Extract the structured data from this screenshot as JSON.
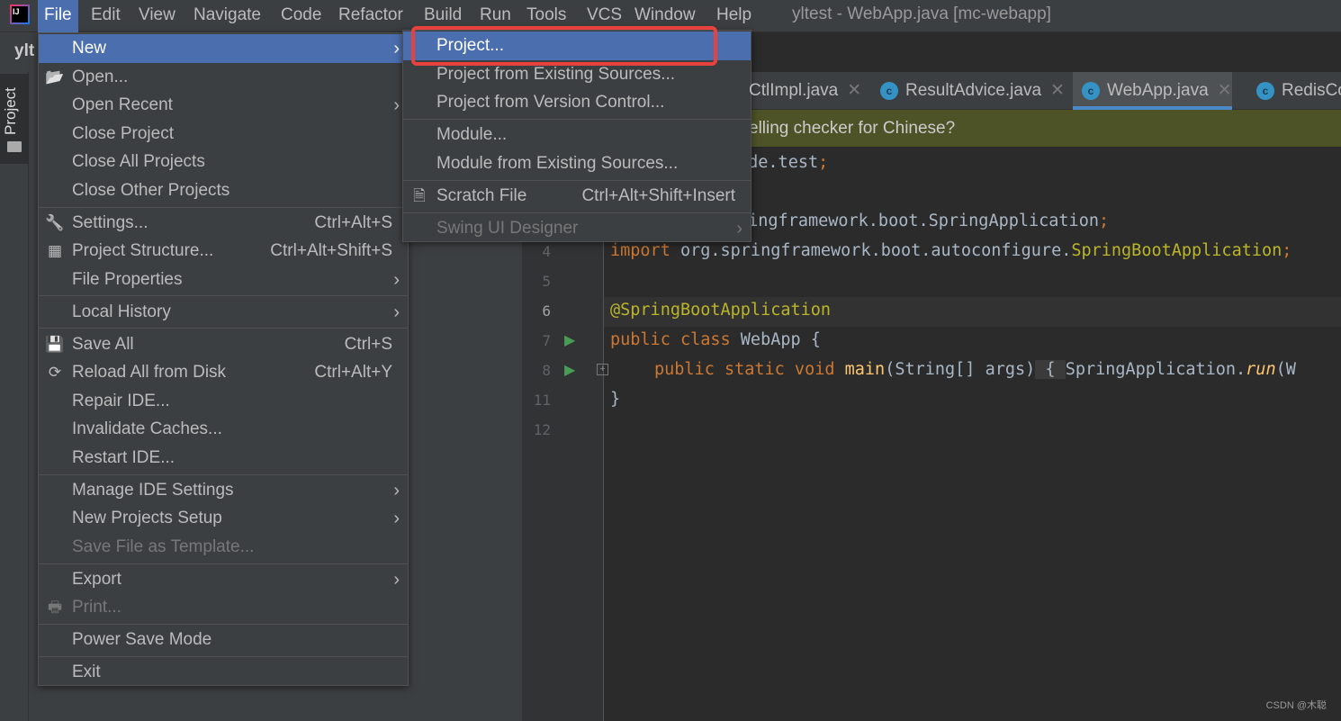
{
  "titlebar": {
    "logo": "IJ",
    "menus": [
      "File",
      "Edit",
      "View",
      "Navigate",
      "Code",
      "Refactor",
      "Build",
      "Run",
      "Tools",
      "VCS",
      "Window",
      "Help"
    ],
    "window_title": "yltest - WebApp.java [mc-webapp]"
  },
  "navbar": {
    "project_name": "ylt"
  },
  "left_toolbar": {
    "project_tab": "Project"
  },
  "tabs": [
    {
      "label": "CtlImpl.java",
      "selected": false
    },
    {
      "label": "ResultAdvice.java",
      "selected": false
    },
    {
      "label": "WebApp.java",
      "selected": true
    },
    {
      "label": "RedisCo",
      "selected": false
    }
  ],
  "notification": "elling checker for Chinese?",
  "file_menu": [
    {
      "label": "New",
      "submenu": true,
      "highlighted": true
    },
    {
      "label": "Open...",
      "icon": "folder-open-icon"
    },
    {
      "label": "Open Recent",
      "submenu": true
    },
    {
      "label": "Close Project"
    },
    {
      "label": "Close All Projects"
    },
    {
      "label": "Close Other Projects"
    },
    {
      "label": "Settings...",
      "shortcut": "Ctrl+Alt+S",
      "icon": "wrench-icon"
    },
    {
      "label": "Project Structure...",
      "shortcut": "Ctrl+Alt+Shift+S",
      "icon": "project-structure-icon"
    },
    {
      "label": "File Properties",
      "submenu": true
    },
    {
      "label": "Local History",
      "submenu": true
    },
    {
      "label": "Save All",
      "shortcut": "Ctrl+S",
      "icon": "save-icon"
    },
    {
      "label": "Reload All from Disk",
      "shortcut": "Ctrl+Alt+Y",
      "icon": "reload-icon"
    },
    {
      "label": "Repair IDE..."
    },
    {
      "label": "Invalidate Caches..."
    },
    {
      "label": "Restart IDE..."
    },
    {
      "label": "Manage IDE Settings",
      "submenu": true
    },
    {
      "label": "New Projects Setup",
      "submenu": true
    },
    {
      "label": "Save File as Template...",
      "disabled": true
    },
    {
      "label": "Export",
      "submenu": true
    },
    {
      "label": "Print...",
      "disabled": true,
      "icon": "print-icon"
    },
    {
      "label": "Power Save Mode"
    },
    {
      "label": "Exit"
    }
  ],
  "new_submenu": [
    {
      "label": "Project...",
      "highlighted": true
    },
    {
      "label": "Project from Existing Sources..."
    },
    {
      "label": "Project from Version Control..."
    },
    {
      "label": "Module..."
    },
    {
      "label": "Module from Existing Sources..."
    },
    {
      "label": "Scratch File",
      "shortcut": "Ctrl+Alt+Shift+Insert",
      "icon": "scratch-file-icon"
    },
    {
      "label": "Swing UI Designer",
      "submenu": true,
      "disabled": true
    }
  ],
  "editor": {
    "line_numbers": [
      "4",
      "5",
      "6",
      "7",
      "8",
      "11",
      "12"
    ],
    "current_line": "6",
    "line1": {
      "text": "ode.test",
      "semi": ";"
    },
    "line3": {
      "text": "ringframework.boot.SpringApplication",
      "semi": ";"
    },
    "line4": {
      "kw": "import",
      "pkg": " org.springframework.boot.autoconfigure.",
      "cls": "SpringBootApplication",
      "semi": ";"
    },
    "line6": "@SpringBootApplication",
    "line7": {
      "kw": "public class",
      "rest": " WebApp {"
    },
    "line8": {
      "kw": "public static void",
      "fn": " main",
      "args": "(String[] args)",
      "fold": " { ",
      "call": "SpringApplication.",
      "run": "run",
      "tail": "(W"
    },
    "line11": "}"
  },
  "watermark": "CSDN @木聪",
  "colors": {
    "accent": "#4b6eaf",
    "highlight_box": "#e8423f",
    "keyword": "#cc7832",
    "annotation": "#bbb529"
  }
}
